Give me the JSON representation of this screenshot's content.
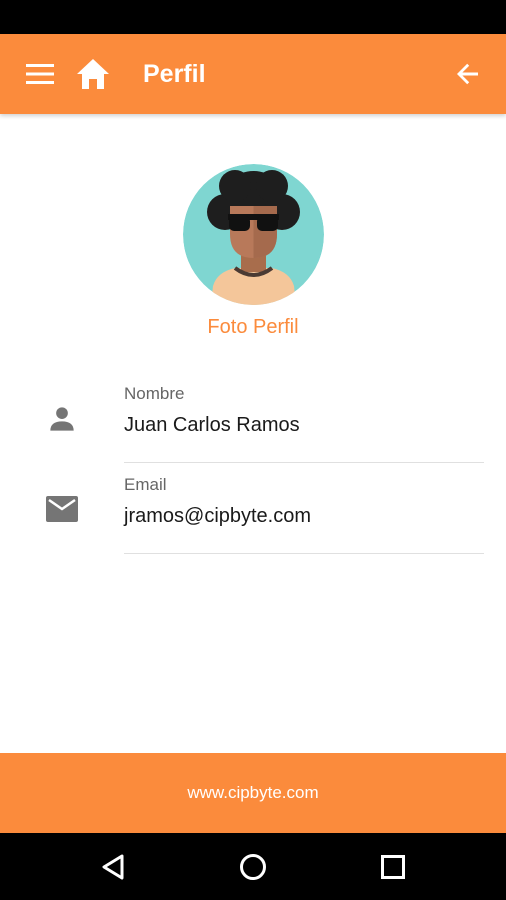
{
  "app_bar": {
    "title": "Perfil",
    "background": "#fb8b3c",
    "icons": [
      "menu-icon",
      "home-icon",
      "arrow-back-icon"
    ]
  },
  "profile": {
    "photo_label": "Foto Perfil",
    "avatar_background": "#7fd6d1"
  },
  "fields": {
    "name": {
      "label": "Nombre",
      "value": "Juan Carlos Ramos",
      "icon": "person-icon"
    },
    "email": {
      "label": "Email",
      "value": "jramos@cipbyte.com",
      "icon": "mail-icon"
    }
  },
  "footer": {
    "link": "www.cipbyte.com"
  },
  "system_nav": {
    "icons": [
      "back-triangle-icon",
      "home-circle-icon",
      "recents-square-icon"
    ]
  },
  "colors": {
    "accent": "#fb8b3c",
    "icon_gray": "#757575",
    "text_primary": "#1a1a1a",
    "text_secondary": "#666666"
  }
}
